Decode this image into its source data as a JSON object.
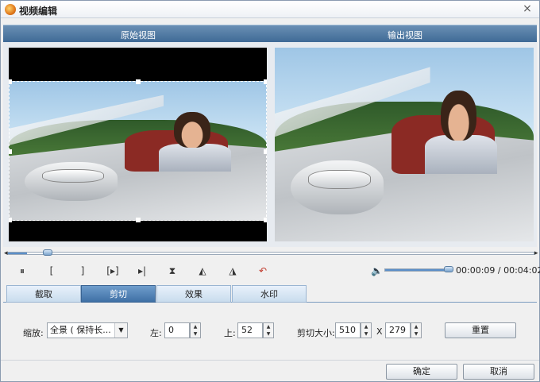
{
  "window": {
    "title": "视频编辑",
    "close_label": "×"
  },
  "views": {
    "original_label": "原始视图",
    "output_label": "输出视图"
  },
  "playback": {
    "progress": 0.037,
    "volume": 1.0,
    "time": "00:00:09 / 00:04:02",
    "controls": [
      "pause",
      "mark-in",
      "mark-out",
      "next-frame",
      "go-end",
      "split",
      "rotate-left",
      "rotate-right",
      "undo"
    ]
  },
  "tabs": [
    {
      "label": "截取",
      "active": false
    },
    {
      "label": "剪切",
      "active": true
    },
    {
      "label": "效果",
      "active": false
    },
    {
      "label": "水印",
      "active": false
    }
  ],
  "crop": {
    "zoom_label": "缩放:",
    "zoom_value": "全景 ( 保持长...",
    "left_label": "左:",
    "left_value": "0",
    "top_label": "上:",
    "top_value": "52",
    "size_label": "剪切大小:",
    "width_value": "510",
    "x_label": "X",
    "height_value": "279",
    "reset_label": "重置"
  },
  "footer": {
    "ok_label": "确定",
    "cancel_label": "取消"
  },
  "icons": {
    "pause": "⏸",
    "mark_in": "[",
    "mark_out": "]",
    "next_frame": "[▸]",
    "go_end": "▸|",
    "split": "⧗",
    "rotate_left": "◭",
    "rotate_right": "◮",
    "undo": "↶",
    "volume": "🔈"
  }
}
